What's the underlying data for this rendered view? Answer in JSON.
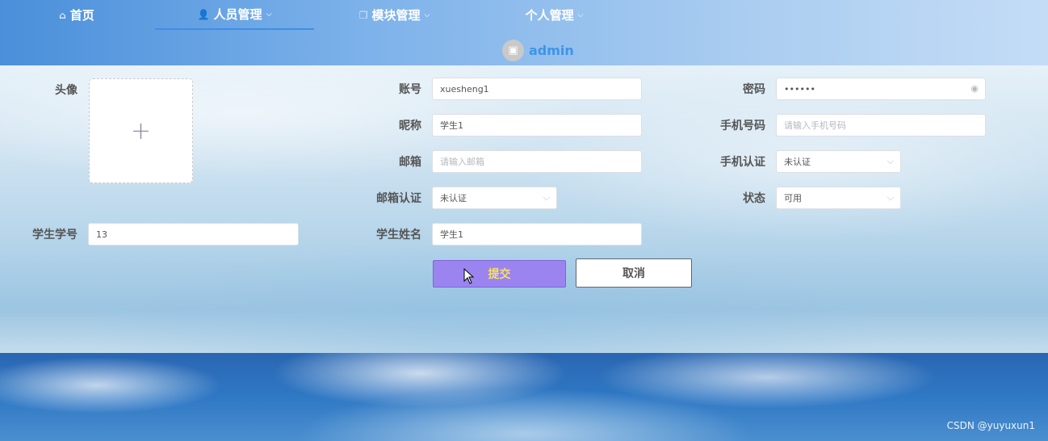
{
  "nav": {
    "items": [
      {
        "label": "首页",
        "icon": "home-icon",
        "icon_glyph": "⌂",
        "has_dropdown": false
      },
      {
        "label": "人员管理",
        "icon": "user-icon",
        "icon_glyph": "👤",
        "has_dropdown": true,
        "active": true
      },
      {
        "label": "模块管理",
        "icon": "module-icon",
        "icon_glyph": "❐",
        "has_dropdown": true
      },
      {
        "label": "个人管理",
        "icon": "",
        "icon_glyph": "",
        "has_dropdown": true
      }
    ],
    "chevron_glyph": "⌵"
  },
  "user": {
    "name": "admin",
    "avatar_icon": "image-icon",
    "avatar_glyph": "▣"
  },
  "form": {
    "avatar_label": "头像",
    "avatar_upload_glyph": "+",
    "account": {
      "label": "账号",
      "value": "xuesheng1"
    },
    "password": {
      "label": "密码",
      "value": "••••••",
      "suffix_icon": "eye-icon",
      "suffix_glyph": "◉"
    },
    "nickname": {
      "label": "昵称",
      "value": "学生1"
    },
    "phone": {
      "label": "手机号码",
      "placeholder": "请输入手机号码"
    },
    "email": {
      "label": "邮箱",
      "placeholder": "请输入邮箱"
    },
    "phone_verify": {
      "label": "手机认证",
      "value": "未认证"
    },
    "email_verify": {
      "label": "邮箱认证",
      "value": "未认证"
    },
    "status": {
      "label": "状态",
      "value": "可用"
    },
    "student_no": {
      "label": "学生学号",
      "value": "13"
    },
    "student_name": {
      "label": "学生姓名",
      "value": "学生1"
    },
    "select_chevron": "⌵"
  },
  "buttons": {
    "submit": "提交",
    "cancel": "取消"
  },
  "colors": {
    "accent": "#3d94e8",
    "submit_bg": "#9b84f0",
    "submit_text": "#f5e063"
  },
  "watermark": "CSDN @yuyuxun1"
}
